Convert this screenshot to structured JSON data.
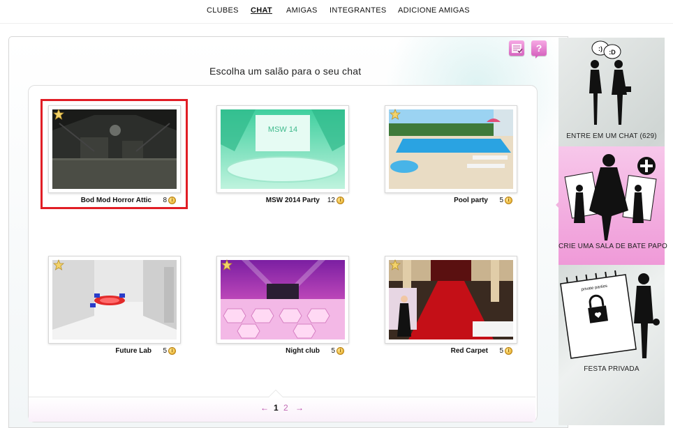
{
  "nav": {
    "items": [
      {
        "label": "CLUBES"
      },
      {
        "label": "CHAT"
      },
      {
        "label": "AMIGAS"
      },
      {
        "label": "INTEGRANTES"
      },
      {
        "label": "ADICIONE AMIGAS"
      }
    ],
    "active": "CHAT"
  },
  "main": {
    "heading": "Escolha um salão para o seu chat",
    "rooms": [
      {
        "name": "Bod Mod Horror Attic",
        "count": "8",
        "starred": true,
        "selected": true
      },
      {
        "name": "MSW 2014 Party",
        "count": "12",
        "starred": false,
        "thumb_text": "MSW 14"
      },
      {
        "name": "Pool party",
        "count": "5",
        "starred": true
      },
      {
        "name": "Future Lab",
        "count": "5",
        "starred": true
      },
      {
        "name": "Night club",
        "count": "5",
        "starred": true
      },
      {
        "name": "Red Carpet",
        "count": "5",
        "starred": true
      }
    ],
    "coin_symbol": "i",
    "pager": {
      "prev": "←",
      "pages": [
        "1",
        "2"
      ],
      "current": "1",
      "next": "→"
    }
  },
  "sidebar": {
    "items": [
      {
        "label": "ENTRE EM UM CHAT (629)",
        "bubble1": ":)",
        "bubble2": ":D"
      },
      {
        "label": "CRIE UMA SALA DE BATE PAPO"
      },
      {
        "label": "FESTA PRIVADA",
        "calendar_text": "private parties"
      }
    ]
  },
  "colors": {
    "accent": "#cc44aa",
    "selected_border": "#e11d25",
    "sidebar_active": "#ef9ad8"
  }
}
